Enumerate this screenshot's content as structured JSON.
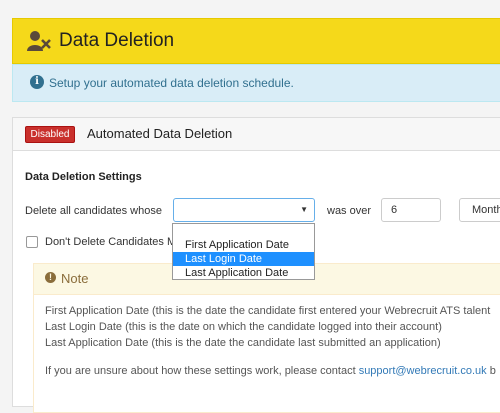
{
  "header": {
    "title": "Data Deletion",
    "icon": "user-delete-icon"
  },
  "info": {
    "text": "Setup your automated data deletion schedule.",
    "icon": "info-icon"
  },
  "panel": {
    "status_badge": "Disabled",
    "title": "Automated Data Deletion",
    "section_title": "Data Deletion Settings",
    "delete_label": "Delete all candidates whose",
    "criteria_value": "",
    "was_over_label": "was over",
    "period_value": "6",
    "period_unit": "Month",
    "dont_delete_label": "Don't Delete Candidates M",
    "dont_delete_checked": false
  },
  "dropdown": {
    "options": [
      "First Application Date",
      "Last Login Date",
      "Last Application Date"
    ],
    "highlighted": "Last Login Date"
  },
  "note": {
    "title": "Note",
    "lines": [
      "First Application Date (this is the date the candidate first entered your Webrecruit ATS talent",
      "Last Login Date (this is the date on which the candidate logged into their account)",
      "Last Application Date (this is the date the candidate last submitted an application)"
    ],
    "contact_prefix": "If you are unsure about how these settings work, please contact ",
    "contact_email": "support@webrecruit.co.uk",
    "contact_suffix": " b"
  },
  "colors": {
    "header_bg": "#f5d91a",
    "info_bg": "#d9edf7",
    "badge_bg": "#c9302c",
    "note_head_bg": "#fcf8e3",
    "selection": "#1e90ff",
    "link": "#337ab7"
  }
}
